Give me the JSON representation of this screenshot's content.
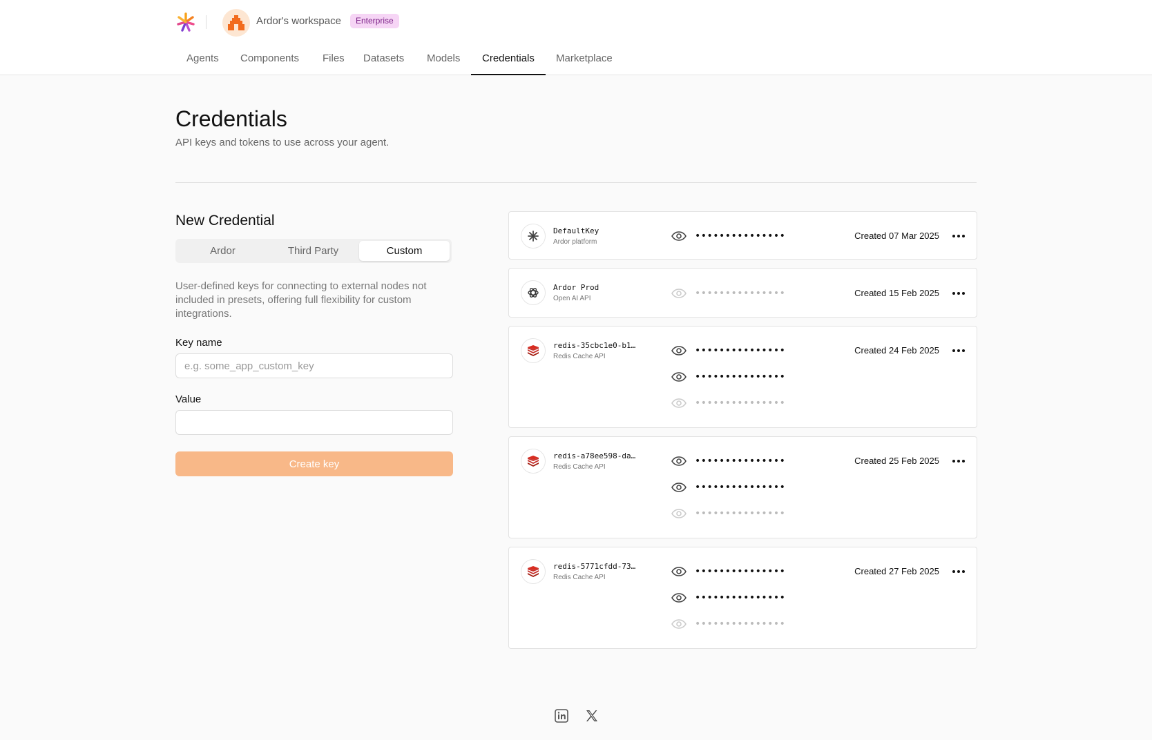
{
  "header": {
    "workspace_name": "Ardor's workspace",
    "plan_badge": "Enterprise"
  },
  "nav": {
    "tabs": [
      {
        "label": "Agents"
      },
      {
        "label": "Components"
      },
      {
        "label": "Files"
      },
      {
        "label": "Datasets"
      },
      {
        "label": "Models"
      },
      {
        "label": "Credentials",
        "active": true
      },
      {
        "label": "Marketplace"
      }
    ]
  },
  "page": {
    "title": "Credentials",
    "subtitle": "API keys and tokens to use across your agent."
  },
  "new_credential": {
    "title": "New Credential",
    "segments": [
      "Ardor",
      "Third Party",
      "Custom"
    ],
    "active_segment": "Custom",
    "description": "User-defined keys for connecting to external nodes not included in presets, offering full flexibility for custom integrations.",
    "key_name_label": "Key name",
    "key_name_placeholder": "e.g. some_app_custom_key",
    "key_name_value": "",
    "value_label": "Value",
    "value_value": "",
    "create_label": "Create key"
  },
  "credentials": [
    {
      "name": "DefaultKey",
      "provider": "Ardor platform",
      "icon": "ardor-asterisk-icon",
      "created": "Created 07 Mar 2025",
      "secrets": [
        {
          "masked": "•••••••••••••••",
          "dim": false
        }
      ]
    },
    {
      "name": "Ardor Prod",
      "provider": "Open AI API",
      "icon": "openai-icon",
      "created": "Created 15 Feb 2025",
      "secrets": [
        {
          "masked": "•••••••••••••••",
          "dim": true
        }
      ]
    },
    {
      "name": "redis-35cbc1e0-b1…",
      "provider": "Redis Cache API",
      "icon": "redis-icon",
      "created": "Created 24 Feb 2025",
      "secrets": [
        {
          "masked": "•••••••••••••••",
          "dim": false
        },
        {
          "masked": "•••••••••••••••",
          "dim": false
        },
        {
          "masked": "•••••••••••••••",
          "dim": true
        }
      ]
    },
    {
      "name": "redis-a78ee598-da…",
      "provider": "Redis Cache API",
      "icon": "redis-icon",
      "created": "Created 25 Feb 2025",
      "secrets": [
        {
          "masked": "•••••••••••••••",
          "dim": false
        },
        {
          "masked": "•••••••••••••••",
          "dim": false
        },
        {
          "masked": "•••••••••••••••",
          "dim": true
        }
      ]
    },
    {
      "name": "redis-5771cfdd-73…",
      "provider": "Redis Cache API",
      "icon": "redis-icon",
      "created": "Created 27 Feb 2025",
      "secrets": [
        {
          "masked": "•••••••••••••••",
          "dim": false
        },
        {
          "masked": "•••••••••••••••",
          "dim": false
        },
        {
          "masked": "•••••••••••••••",
          "dim": true
        }
      ]
    }
  ],
  "footer": {
    "links": [
      {
        "icon": "linkedin-icon"
      },
      {
        "icon": "x-twitter-icon"
      }
    ]
  },
  "colors": {
    "accent": "#f8b888",
    "badge_bg": "#f6d5f5",
    "badge_text": "#7a1f86",
    "redis_red": "#c6302b"
  }
}
